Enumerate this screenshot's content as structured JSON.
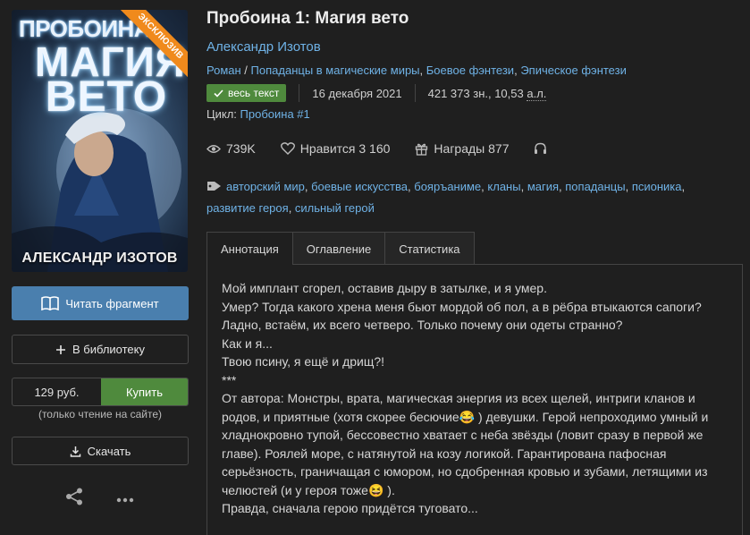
{
  "cover": {
    "series_text": "ПРОБОИНА",
    "title_line1": "МАГИЯ",
    "title_line2": "ВЕТО",
    "author_text": "АЛЕКСАНДР ИЗОТОВ",
    "ribbon": "ЭКСКЛЮЗИВ"
  },
  "actions": {
    "read_fragment": "Читать фрагмент",
    "add_library": "В библиотеку",
    "price": "129 руб.",
    "buy": "Купить",
    "buy_note": "(только чтение на сайте)",
    "download": "Скачать"
  },
  "book": {
    "title": "Пробоина 1: Магия вето",
    "author": "Александр Изотов",
    "genres": [
      "Роман",
      "Попаданцы в магические миры",
      "Боевое фэнтези",
      "Эпическое фэнтези"
    ],
    "genre_sep_first": " / ",
    "genre_sep": ", ",
    "full_text_badge": "весь текст",
    "date": "16 декабря 2021",
    "size_prefix": "421 373 зн., 10,53 ",
    "size_unit": "а.л.",
    "cycle_label": "Цикл:",
    "cycle_value": "Пробоина #1"
  },
  "stats": {
    "views": "739K",
    "likes_label": "Нравится",
    "likes": "3 160",
    "awards_label": "Награды",
    "awards": "877"
  },
  "tags": [
    "авторский мир",
    "боевые искусства",
    "бояръаниме",
    "кланы",
    "магия",
    "попаданцы",
    "псионика",
    "развитие героя",
    "сильный герой"
  ],
  "tabs": [
    "Аннотация",
    "Оглавление",
    "Статистика"
  ],
  "annotation": [
    "Мой имплант сгорел, оставив дыру в затылке, и я умер.",
    "Умер? Тогда какого хрена меня бьют мордой об пол, а в рёбра втыкаются сапоги?",
    "Ладно, встаём, их всего четверо. Только почему они одеты странно?",
    "Как и я...",
    "Твою псину, я ещё и дрищ?!",
    "***",
    "От автора: Монстры, врата, магическая энергия из всех щелей, интриги кланов и",
    "родов, и приятные (хотя скорее бесючие😂 ) девушки. Герой непроходимо умный и",
    "хладнокровно тупой, бессовестно хватает с неба звёзды (ловит сразу в первой же",
    "главе). Роялей море, с натянутой на козу логикой. Гарантирована пафосная",
    "серьёзность, граничащая с юмором, но сдобренная кровью и зубами, летящими из",
    "челюстей (и у героя тоже😆 ).",
    "Правда, сначала герою придётся туговато..."
  ],
  "colors": {
    "background": "#1f1f1f",
    "link": "#6fb2e6",
    "read_button": "#4a7fae",
    "buy_green": "#4f8a3d",
    "ribbon_orange": "#f08a1c"
  }
}
